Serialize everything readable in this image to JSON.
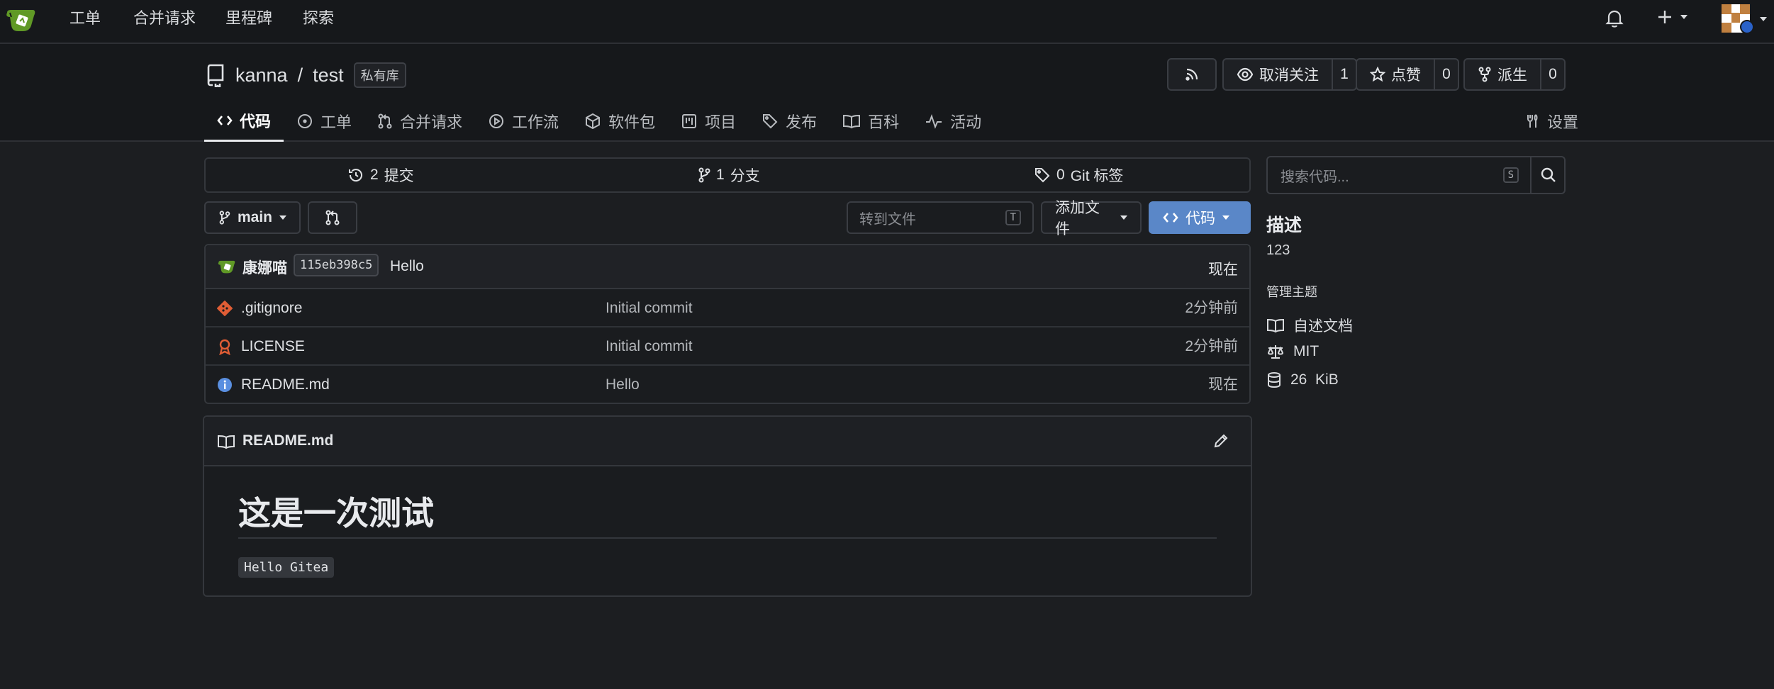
{
  "topnav": {
    "links": [
      "工单",
      "合并请求",
      "里程碑",
      "探索"
    ],
    "plus_icon": "plus-icon",
    "bell_icon": "bell-icon"
  },
  "repo": {
    "owner": "kanna",
    "separator": "/",
    "name": "test",
    "visibility_badge": "私有库",
    "watch": {
      "label": "取消关注",
      "count": "1"
    },
    "star": {
      "label": "点赞",
      "count": "0"
    },
    "fork": {
      "label": "派生",
      "count": "0"
    }
  },
  "tabs": [
    {
      "label": "代码",
      "icon": "code-icon",
      "active": true
    },
    {
      "label": "工单",
      "icon": "issue-icon"
    },
    {
      "label": "合并请求",
      "icon": "pull-request-icon"
    },
    {
      "label": "工作流",
      "icon": "play-icon"
    },
    {
      "label": "软件包",
      "icon": "package-icon"
    },
    {
      "label": "项目",
      "icon": "project-icon"
    },
    {
      "label": "发布",
      "icon": "tag-icon"
    },
    {
      "label": "百科",
      "icon": "book-icon"
    },
    {
      "label": "活动",
      "icon": "pulse-icon"
    }
  ],
  "settings_tab": "设置",
  "stats": {
    "commits_count": "2",
    "commits_label": "提交",
    "branches_count": "1",
    "branches_label": "分支",
    "tags_count": "0",
    "tags_label": "Git 标签"
  },
  "branch": {
    "name": "main"
  },
  "goto_file_placeholder": "转到文件",
  "goto_file_shortcut": "T",
  "add_file_label": "添加文件",
  "code_button_label": "代码",
  "last_commit": {
    "author": "康娜喵",
    "sha": "115eb398c5",
    "message": "Hello",
    "time": "现在"
  },
  "files": [
    {
      "name": ".gitignore",
      "icon": "git-icon",
      "commit": "Initial commit",
      "time": "2分钟前"
    },
    {
      "name": "LICENSE",
      "icon": "license-icon",
      "commit": "Initial commit",
      "time": "2分钟前"
    },
    {
      "name": "README.md",
      "icon": "info-icon",
      "commit": "Hello",
      "time": "现在"
    }
  ],
  "readme": {
    "filename": "README.md",
    "heading": "这是一次测试",
    "code_text": "Hello Gitea"
  },
  "sidebar": {
    "search_placeholder": "搜索代码...",
    "search_shortcut": "S",
    "description_title": "描述",
    "description_text": "123",
    "manage_topics": "管理主题",
    "readme_link": "自述文档",
    "license": "MIT",
    "size": "26  KiB"
  },
  "colors": {
    "accent": "#5a87c8",
    "background": "#1c1e21",
    "header_bg": "#16181b"
  }
}
